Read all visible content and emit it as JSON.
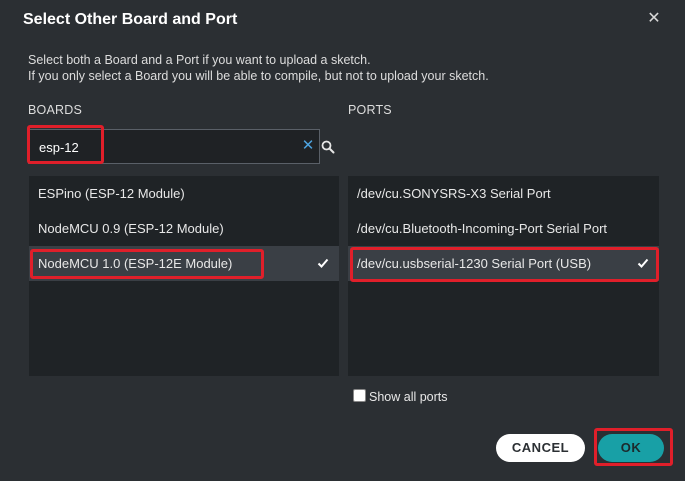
{
  "dialog": {
    "title": "Select Other Board and Port",
    "description_line1": "Select both a Board and a Port if you want to upload a sketch.",
    "description_line2": "If you only select a Board you will be able to compile, but not to upload your sketch."
  },
  "boards": {
    "heading": "BOARDS",
    "search_value": "esp-12",
    "items": [
      {
        "label": "ESPino (ESP-12 Module)",
        "selected": false
      },
      {
        "label": "NodeMCU 0.9 (ESP-12 Module)",
        "selected": false
      },
      {
        "label": "NodeMCU 1.0 (ESP-12E Module)",
        "selected": true
      }
    ]
  },
  "ports": {
    "heading": "PORTS",
    "items": [
      {
        "label": "/dev/cu.SONYSRS-X3 Serial Port",
        "selected": false
      },
      {
        "label": "/dev/cu.Bluetooth-Incoming-Port Serial Port",
        "selected": false
      },
      {
        "label": "/dev/cu.usbserial-1230 Serial Port (USB)",
        "selected": true
      }
    ],
    "show_all_label": "Show all ports",
    "show_all_checked": false
  },
  "buttons": {
    "cancel": "CANCEL",
    "ok": "OK"
  },
  "icons": {
    "close": "close-icon",
    "clear": "clear-icon",
    "search": "search-icon",
    "check": "checkmark-icon"
  },
  "colors": {
    "background": "#2b2f33",
    "list_background": "#1f2326",
    "selected_row": "#3a3f45",
    "ok_button": "#18a0a6",
    "highlight_box": "#e01f2a",
    "clear_icon": "#4da3e0"
  }
}
